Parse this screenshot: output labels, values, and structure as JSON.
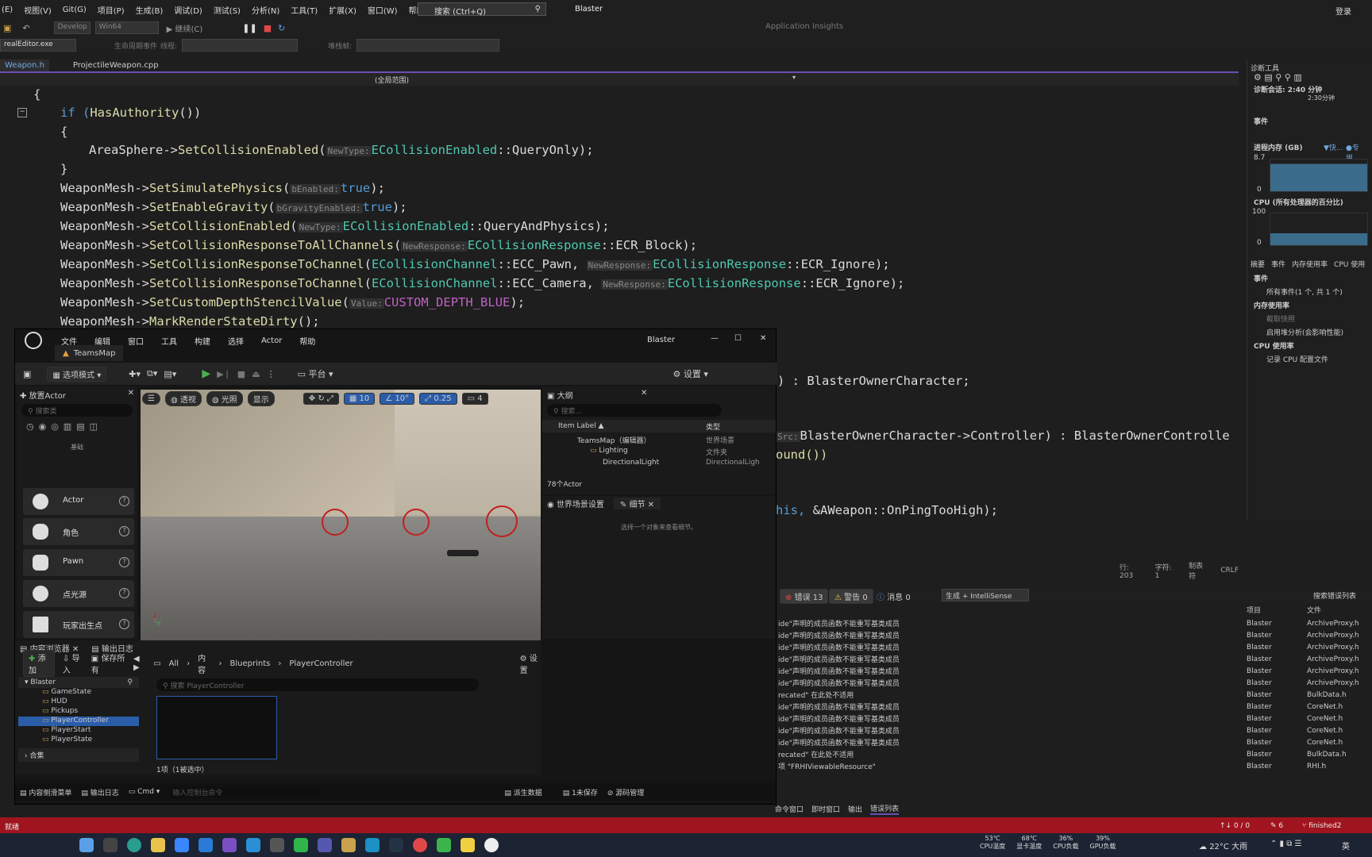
{
  "vs": {
    "menu": [
      "(E)",
      "视图(V)",
      "Git(G)",
      "项目(P)",
      "生成(B)",
      "调试(D)",
      "测试(S)",
      "分析(N)",
      "工具(T)",
      "扩展(X)",
      "窗口(W)",
      "帮助(H)"
    ],
    "search_placeholder": "搜索 (Ctrl+Q)",
    "solution": "Blaster",
    "login": "登录",
    "config": "Develop",
    "platform": "Win64",
    "continue": "继续(C)",
    "insights": "Application Insights",
    "process": "realEditor.exe",
    "lifecycle": "生命周期事件",
    "thread": "线程:",
    "stackframe": "堆栈帧:",
    "tabs": [
      "Weapon.h",
      "ProjectileWeapon.cpp"
    ],
    "scope": "(全局范围)",
    "status_line": "行: 203",
    "status_col": "字符: 1",
    "status_tab": "制表符",
    "status_eol": "CRLF",
    "right_tabs": [
      "命令窗口",
      "即时窗口",
      "输出",
      "错误列表"
    ]
  },
  "code": {
    "l1": "{",
    "l2a": "if (",
    "l2b": "HasAuthority",
    "l2c": "())",
    "l3": "{",
    "l4a": "AreaSphere->",
    "l4b": "SetCollisionEnabled",
    "l4c": "(",
    "l4h": "NewType:",
    "l4d": "ECollisionEnabled",
    "l4e": "::QueryOnly);",
    "l5": "}",
    "l6a": "WeaponMesh->",
    "l6b": "SetSimulatePhysics",
    "l6c": "(",
    "l6h": "bEnabled:",
    "l6d": "true",
    ");": ");",
    "l7a": "WeaponMesh->",
    "l7b": "SetEnableGravity",
    "l7c": "(",
    "l7h": "bGravityEnabled:",
    "l7d": "true",
    "l8a": "WeaponMesh->",
    "l8b": "SetCollisionEnabled",
    "l8h": "NewType:",
    "l8d": "ECollisionEnabled",
    "l8e": "::QueryAndPhysics);",
    "l9a": "WeaponMesh->",
    "l9b": "SetCollisionResponseToAllChannels",
    "l9h": "NewResponse:",
    "l9d": "ECollisionResponse",
    "l9e": "::ECR_Block);",
    "l10b": "SetCollisionResponseToChannel",
    "l10d": "ECollisionChannel",
    "l10e": "::ECC_Pawn,",
    "l10h": "NewResponse:",
    "l10f": "ECollisionResponse",
    "l10g": "::ECR_Ignore);",
    "l11e": "::ECC_Camera,",
    "l12b": "SetCustomDepthStencilValue",
    "l12h": "Value:",
    "l12d": "CUSTOM_DEPTH_BLUE",
    "l13b": "MarkRenderStateDirty",
    "r1": ") : BlasterOwnerCharacter;",
    "r2h": "Src:",
    "r2": "BlasterOwnerCharacter->Controller) : BlasterOwnerControlle",
    "r3": "ound())",
    "r4a": "his,",
    "r4b": "&AWeapon::OnPingTooHigh);"
  },
  "diag": {
    "title": "诊断工具",
    "session": "诊断会话: 2:40 分钟",
    "tick": "2:30分钟",
    "events": "事件",
    "memory": "进程内存 (GB)",
    "mem_fast": "▼快...",
    "mem_dedicated": "●专用...",
    "mem_max": "8.7",
    "mem_min": "0",
    "cpu": "CPU (所有处理器的百分比)",
    "cpu_max": "100",
    "cpu_min": "0",
    "subtabs": [
      "摘要",
      "事件",
      "内存使用率",
      "CPU 使用"
    ],
    "ev_section": "事件",
    "ev_all": "所有事件(1 个, 共 1 个)",
    "mem_section": "内存使用率",
    "snapshot": "截取快照",
    "heap": "启用堆分析(会影响性能)",
    "cpu_section": "CPU 使用率",
    "cpu_record": "记录 CPU 配置文件"
  },
  "errors": {
    "err_count": "错误 13",
    "warn_count": "警告 0",
    "msg_count": "消息 0",
    "build_filter": "生成 + IntelliSense",
    "search": "搜索错误列表",
    "col_project": "项目",
    "col_file": "文件",
    "rows": [
      {
        "d": "ide\"声明的成员函数不能重写基类成员",
        "p": "Blaster",
        "f": "ArchiveProxy.h"
      },
      {
        "d": "ide\"声明的成员函数不能重写基类成员",
        "p": "Blaster",
        "f": "ArchiveProxy.h"
      },
      {
        "d": "ide\"声明的成员函数不能重写基类成员",
        "p": "Blaster",
        "f": "ArchiveProxy.h"
      },
      {
        "d": "ide\"声明的成员函数不能重写基类成员",
        "p": "Blaster",
        "f": "ArchiveProxy.h"
      },
      {
        "d": "ide\"声明的成员函数不能重写基类成员",
        "p": "Blaster",
        "f": "ArchiveProxy.h"
      },
      {
        "d": "ide\"声明的成员函数不能重写基类成员",
        "p": "Blaster",
        "f": "ArchiveProxy.h"
      },
      {
        "d": "recated\" 在此处不适用",
        "p": "Blaster",
        "f": "BulkData.h"
      },
      {
        "d": "ide\"声明的成员函数不能重写基类成员",
        "p": "Blaster",
        "f": "CoreNet.h"
      },
      {
        "d": "ide\"声明的成员函数不能重写基类成员",
        "p": "Blaster",
        "f": "CoreNet.h"
      },
      {
        "d": "ide\"声明的成员函数不能重写基类成员",
        "p": "Blaster",
        "f": "CoreNet.h"
      },
      {
        "d": "ide\"声明的成员函数不能重写基类成员",
        "p": "Blaster",
        "f": "CoreNet.h"
      },
      {
        "d": "recated\" 在此处不适用",
        "p": "Blaster",
        "f": "BulkData.h"
      },
      {
        "d": "项 \"FRHIViewableResource\"",
        "p": "Blaster",
        "f": "RHI.h"
      }
    ]
  },
  "ue": {
    "menu": [
      "文件",
      "编辑",
      "窗口",
      "工具",
      "构建",
      "选择",
      "Actor",
      "帮助"
    ],
    "title": "Blaster",
    "map_tab": "TeamsMap",
    "mode": "选项模式",
    "platform": "平台",
    "settings": "设置",
    "place_actor": "放置Actor",
    "search_ph": "搜索类",
    "basic": "基础",
    "actors": [
      "Actor",
      "角色",
      "Pawn",
      "点光源",
      "玩家出生点"
    ],
    "vp_perspective": "透视",
    "vp_lit": "光照",
    "vp_show": "显示",
    "vp_grid": "10",
    "vp_angle": "10°",
    "vp_scale": "0.25",
    "vp_cam": "4",
    "outliner": "大纲",
    "outliner_search": "搜索...",
    "col_label": "Item Label ▲",
    "col_type": "类型",
    "tree": [
      {
        "label": "TeamsMap（编辑器）",
        "type": "世界场景"
      },
      {
        "label": "Lighting",
        "type": "文件夹"
      },
      {
        "label": "DirectionalLight",
        "type": "DirectionalLigh"
      }
    ],
    "actor_count": "78个Actor",
    "world_settings": "世界场景设置",
    "details": "细节",
    "details_empty": "选择一个对象来查看细节。",
    "cb_tab": "内容浏览器",
    "log_tab": "输出日志",
    "add": "添加",
    "import": "导入",
    "save_all": "保存所有",
    "crumbs": [
      "All",
      "内容",
      "Blueprints",
      "PlayerController"
    ],
    "cb_settings": "设置",
    "root": "Blaster",
    "folders": [
      "GameState",
      "HUD",
      "Pickups",
      "PlayerController",
      "PlayerStart",
      "PlayerState"
    ],
    "collections": "合集",
    "asset_search": "搜索 PlayerController",
    "selection": "1项（1被选中）",
    "bottom_drawer": "内容侧滑菜单",
    "bottom_log": "输出日志",
    "cmd": "Cmd",
    "console_ph": "输入控制台命令",
    "derived": "派生数据",
    "unsaved": "1未保存",
    "source": "源码管理"
  },
  "status": {
    "left": "就绪",
    "sync": "↑↓ 0 / 0",
    "pencil": "6",
    "branch": "finished2"
  },
  "taskbar": {
    "temps": [
      {
        "v": "53℃",
        "l": "CPU温度"
      },
      {
        "v": "68℃",
        "l": "显卡温度"
      },
      {
        "v": "36%",
        "l": "CPU负载"
      },
      {
        "v": "39%",
        "l": "GPU负载"
      }
    ],
    "weather": "22°C 大雨",
    "lang": "英"
  }
}
